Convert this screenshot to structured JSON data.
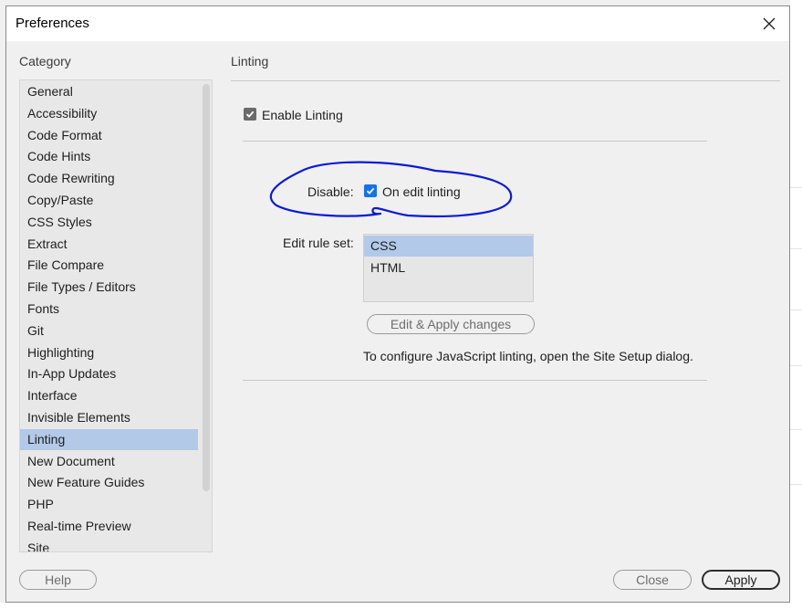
{
  "window": {
    "title": "Preferences"
  },
  "sidebar": {
    "heading": "Category",
    "items": [
      {
        "label": "General"
      },
      {
        "label": "Accessibility"
      },
      {
        "label": "Code Format"
      },
      {
        "label": "Code Hints"
      },
      {
        "label": "Code Rewriting"
      },
      {
        "label": "Copy/Paste"
      },
      {
        "label": "CSS Styles"
      },
      {
        "label": "Extract"
      },
      {
        "label": "File Compare"
      },
      {
        "label": "File Types / Editors"
      },
      {
        "label": "Fonts"
      },
      {
        "label": "Git"
      },
      {
        "label": "Highlighting"
      },
      {
        "label": "In-App Updates"
      },
      {
        "label": "Interface"
      },
      {
        "label": "Invisible Elements"
      },
      {
        "label": "Linting",
        "selected": true
      },
      {
        "label": "New Document"
      },
      {
        "label": "New Feature Guides"
      },
      {
        "label": "PHP"
      },
      {
        "label": "Real-time Preview"
      },
      {
        "label": "Site"
      }
    ]
  },
  "main": {
    "title": "Linting",
    "enable_linting": {
      "label": "Enable Linting",
      "checked": true
    },
    "disable_label": "Disable:",
    "on_edit_linting": {
      "label": "On edit linting",
      "checked": true
    },
    "rule_set_label": "Edit rule set:",
    "rule_sets": [
      {
        "label": "CSS",
        "selected": true
      },
      {
        "label": "HTML"
      }
    ],
    "edit_apply_label": "Edit  & Apply changes",
    "js_note": "To configure JavaScript linting, open the Site Setup dialog."
  },
  "footer": {
    "help_label": "Help",
    "close_label": "Close",
    "apply_label": "Apply"
  },
  "colors": {
    "selection": "#b2c9e8",
    "checkbox_blue": "#1473e6",
    "checkbox_gray": "#6b6b6b",
    "annotation_ink": "#0a1bd6"
  },
  "icons": {
    "close": "close-icon",
    "check": "checkmark-icon"
  }
}
